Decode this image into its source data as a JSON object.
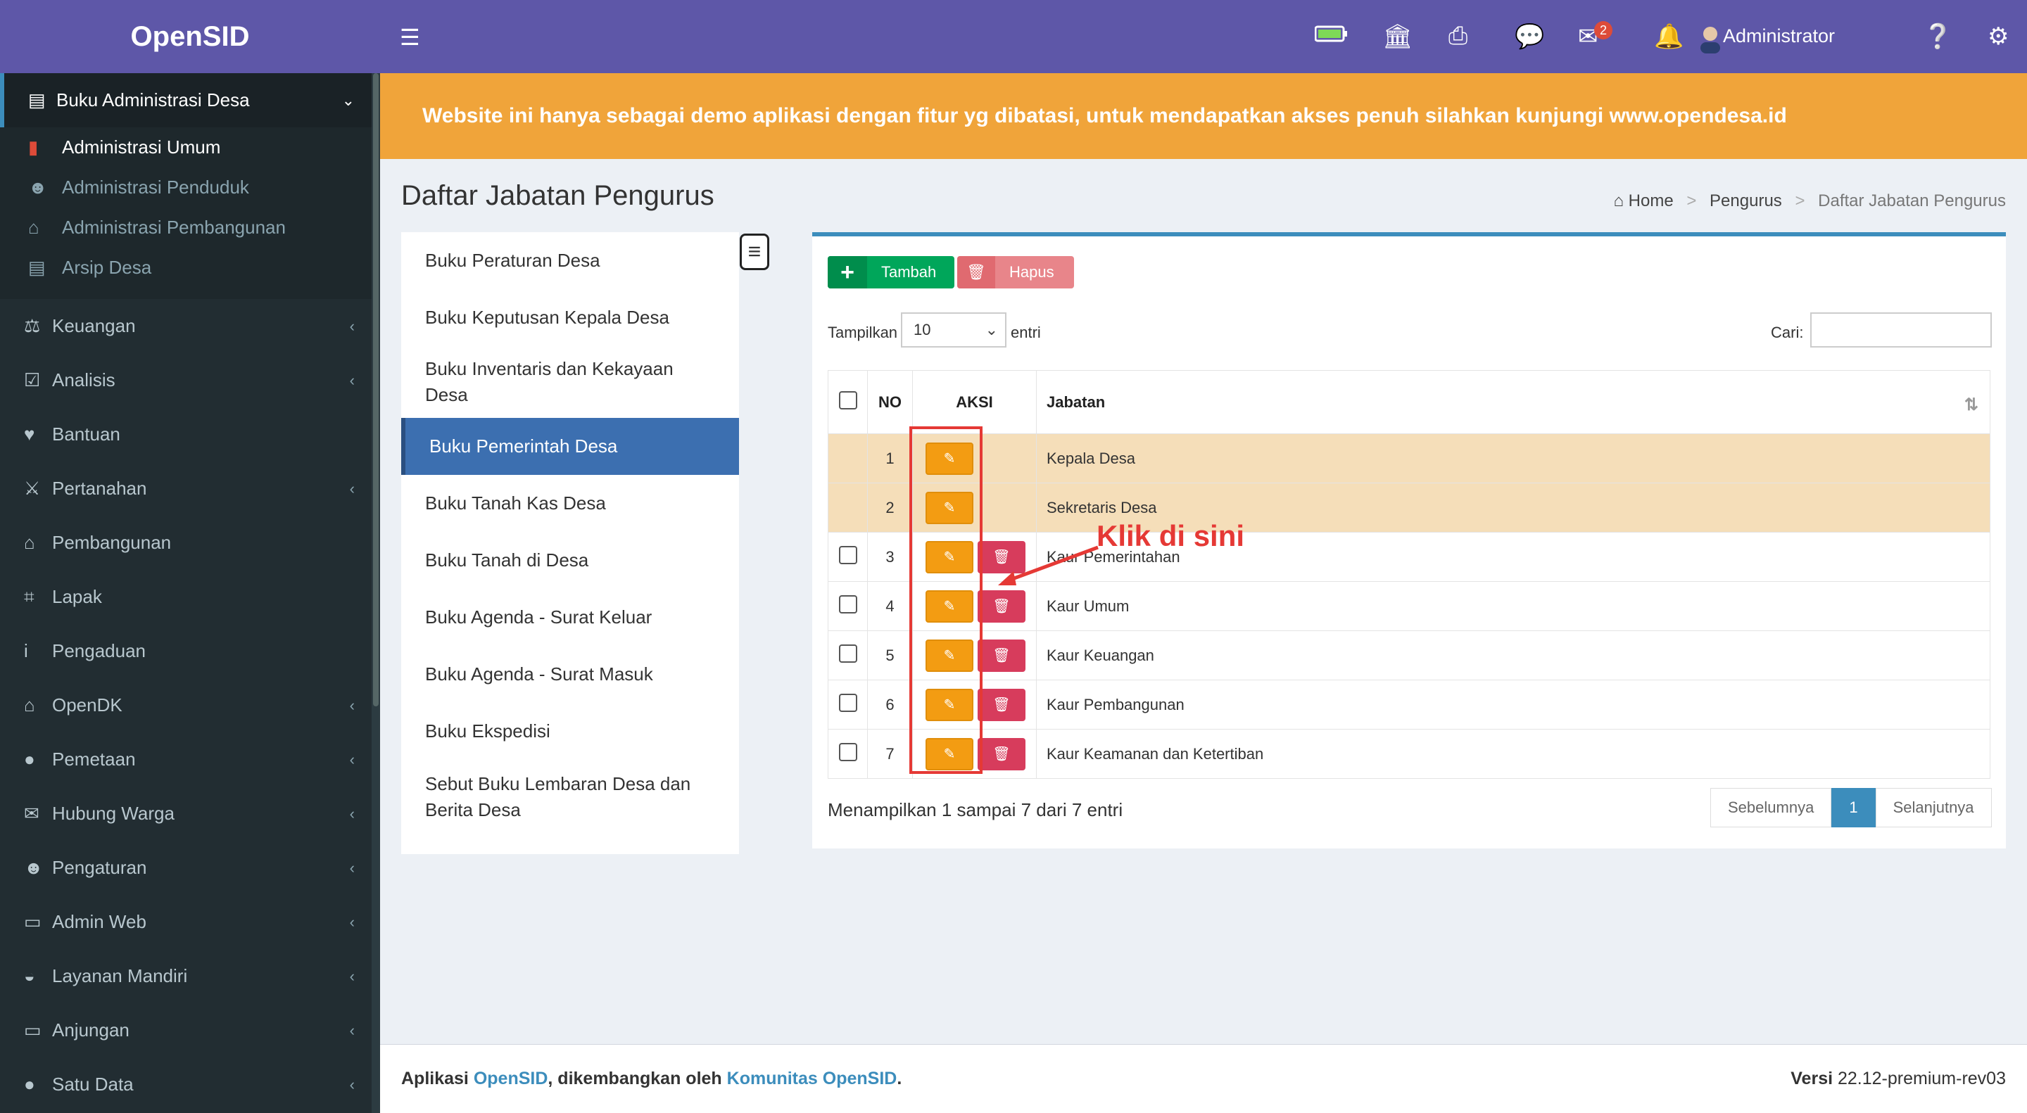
{
  "app": {
    "logo": "OpenSID"
  },
  "sidebar": {
    "active_group": {
      "label": "Buku Administrasi Desa",
      "icon": "book-icon"
    },
    "sub_items": [
      {
        "label": "Administrasi Umum",
        "icon": "bookmark-icon",
        "active": true
      },
      {
        "label": "Administrasi Penduduk",
        "icon": "users-icon"
      },
      {
        "label": "Administrasi Pembangunan",
        "icon": "bank-icon"
      },
      {
        "label": "Arsip Desa",
        "icon": "archive-icon"
      }
    ],
    "items": [
      {
        "label": "Keuangan",
        "icon": "balance-scale-icon",
        "chevron": true
      },
      {
        "label": "Analisis",
        "icon": "check-square-icon",
        "chevron": true
      },
      {
        "label": "Bantuan",
        "icon": "heart-icon",
        "chevron": false
      },
      {
        "label": "Pertanahan",
        "icon": "road-sign-icon",
        "chevron": true
      },
      {
        "label": "Pembangunan",
        "icon": "bank-icon",
        "chevron": false
      },
      {
        "label": "Lapak",
        "icon": "cart-icon",
        "chevron": false
      },
      {
        "label": "Pengaduan",
        "icon": "info-icon",
        "chevron": false
      },
      {
        "label": "OpenDK",
        "icon": "bank-icon",
        "chevron": true
      },
      {
        "label": "Pemetaan",
        "icon": "globe-icon",
        "chevron": true
      },
      {
        "label": "Hubung Warga",
        "icon": "envelope-icon",
        "chevron": true
      },
      {
        "label": "Pengaturan",
        "icon": "users-icon",
        "chevron": true
      },
      {
        "label": "Admin Web",
        "icon": "desktop-icon",
        "chevron": true
      },
      {
        "label": "Layanan Mandiri",
        "icon": "inbox-icon",
        "chevron": true
      },
      {
        "label": "Anjungan",
        "icon": "desktop-icon",
        "chevron": true
      },
      {
        "label": "Satu Data",
        "icon": "globe-icon",
        "chevron": true
      }
    ]
  },
  "topbar": {
    "user": "Administrator",
    "mail_badge": "2"
  },
  "banner": "Website ini hanya sebagai demo aplikasi dengan fitur yg dibatasi, untuk mendapatkan akses penuh silahkan kunjungi www.opendesa.id",
  "page": {
    "title": "Daftar Jabatan Pengurus"
  },
  "breadcrumb": {
    "home": "Home",
    "parent": "Pengurus",
    "current": "Daftar Jabatan Pengurus"
  },
  "book_menu": [
    {
      "label": "Buku Peraturan Desa"
    },
    {
      "label": "Buku Keputusan Kepala Desa"
    },
    {
      "label": "Buku Inventaris dan Kekayaan Desa"
    },
    {
      "label": "Buku Pemerintah Desa",
      "active": true
    },
    {
      "label": "Buku Tanah Kas Desa"
    },
    {
      "label": "Buku Tanah di Desa"
    },
    {
      "label": "Buku Agenda - Surat Keluar"
    },
    {
      "label": "Buku Agenda - Surat Masuk"
    },
    {
      "label": "Buku Ekspedisi"
    },
    {
      "label": "Sebut Buku Lembaran Desa dan Berita Desa"
    }
  ],
  "toolbar": {
    "add": "Tambah",
    "delete": "Hapus"
  },
  "table_controls": {
    "show_label": "Tampilkan",
    "length": "10",
    "entries_label": "entri",
    "search_label": "Cari:"
  },
  "table": {
    "headers": {
      "no": "NO",
      "aksi": "AKSI",
      "jabatan": "Jabatan"
    },
    "rows": [
      {
        "no": "1",
        "jabatan": "Kepala Desa",
        "fixed": true
      },
      {
        "no": "2",
        "jabatan": "Sekretaris Desa",
        "fixed": true
      },
      {
        "no": "3",
        "jabatan": "Kaur Pemerintahan",
        "fixed": false
      },
      {
        "no": "4",
        "jabatan": "Kaur Umum",
        "fixed": false
      },
      {
        "no": "5",
        "jabatan": "Kaur Keuangan",
        "fixed": false
      },
      {
        "no": "6",
        "jabatan": "Kaur Pembangunan",
        "fixed": false
      },
      {
        "no": "7",
        "jabatan": "Kaur Keamanan dan Ketertiban",
        "fixed": false
      }
    ]
  },
  "annotation": "Klik di sini",
  "info": "Menampilkan 1 sampai 7 dari 7 entri",
  "pagination": {
    "prev": "Sebelumnya",
    "current": "1",
    "next": "Selanjutnya"
  },
  "footer": {
    "prefix": "Aplikasi ",
    "app_link": "OpenSID",
    "middle": ", dikembangkan oleh ",
    "community_link": "Komunitas OpenSID",
    "end": ".",
    "version_label": "Versi",
    "version": "22.12-premium-rev03"
  },
  "colors": {
    "brand": "#5e57a8",
    "banner": "#f0a43a",
    "sidebar": "#222d32",
    "accent": "#3c8dbc"
  }
}
